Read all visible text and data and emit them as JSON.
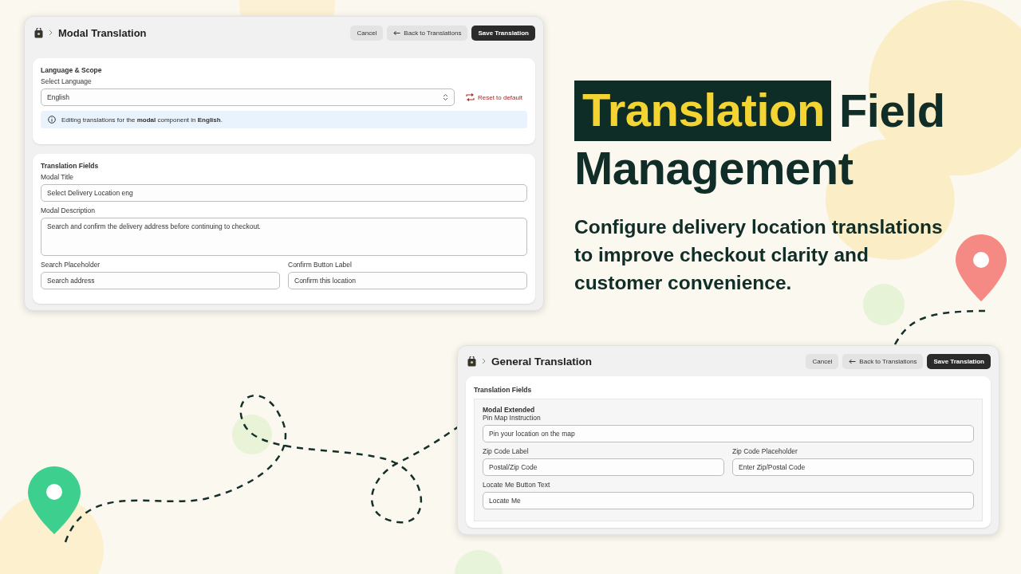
{
  "windows": [
    {
      "title": "Modal Translation",
      "buttons": [
        {
          "label": "Cancel",
          "kind": "plain"
        },
        {
          "label": "Back to Translations",
          "kind": "back"
        },
        {
          "label": "Save Translation",
          "kind": "primary"
        }
      ],
      "cards": [
        {
          "heading": "Language & Scope",
          "rows": [
            [
              {
                "label": "Select Language",
                "kind": "select",
                "value": "English",
                "action": "Reset to default"
              }
            ]
          ],
          "note": "Editing translations for the **modal** component in **English**."
        },
        {
          "heading": "Translation Fields",
          "rows": [
            [
              {
                "label": "Modal Title",
                "kind": "input",
                "value": "Select Delivery Location eng"
              }
            ],
            [
              {
                "label": "Modal Description",
                "kind": "textarea",
                "value": "Search and confirm the delivery address before continuing to checkout."
              }
            ],
            [
              {
                "label": "Search Placeholder",
                "kind": "input",
                "value": "Search address"
              },
              {
                "label": "Confirm Button Label",
                "kind": "input",
                "value": "Confirm this location"
              }
            ]
          ]
        }
      ]
    },
    {
      "title": "General Translation",
      "buttons": [
        {
          "label": "Cancel",
          "kind": "plain"
        },
        {
          "label": "Back to Translations",
          "kind": "back"
        },
        {
          "label": "Save Translation",
          "kind": "primary"
        }
      ],
      "cards": [
        {
          "heading": "Translation Fields",
          "panel": {
            "heading": "Modal Extended",
            "rows": [
              [
                {
                  "label": "Pin Map Instruction",
                  "kind": "input",
                  "value": "Pin your location on the map"
                }
              ],
              [
                {
                  "label": "Zip Code Label",
                  "kind": "input",
                  "value": "Postal/Zip Code"
                },
                {
                  "label": "Zip Code Placeholder",
                  "kind": "input",
                  "value": "Enter Zip/Postal Code"
                }
              ],
              [
                {
                  "label": "Locate Me Button Text",
                  "kind": "input",
                  "value": "Locate Me"
                }
              ]
            ]
          }
        }
      ]
    }
  ],
  "headline": [
    [
      {
        "text": "Translation",
        "highlighted": true
      },
      {
        "text": "Field",
        "highlighted": false
      }
    ],
    [
      {
        "text": "Management",
        "highlighted": false
      }
    ]
  ],
  "subtitle": "Configure delivery location translations to improve checkout clarity and customer convenience."
}
